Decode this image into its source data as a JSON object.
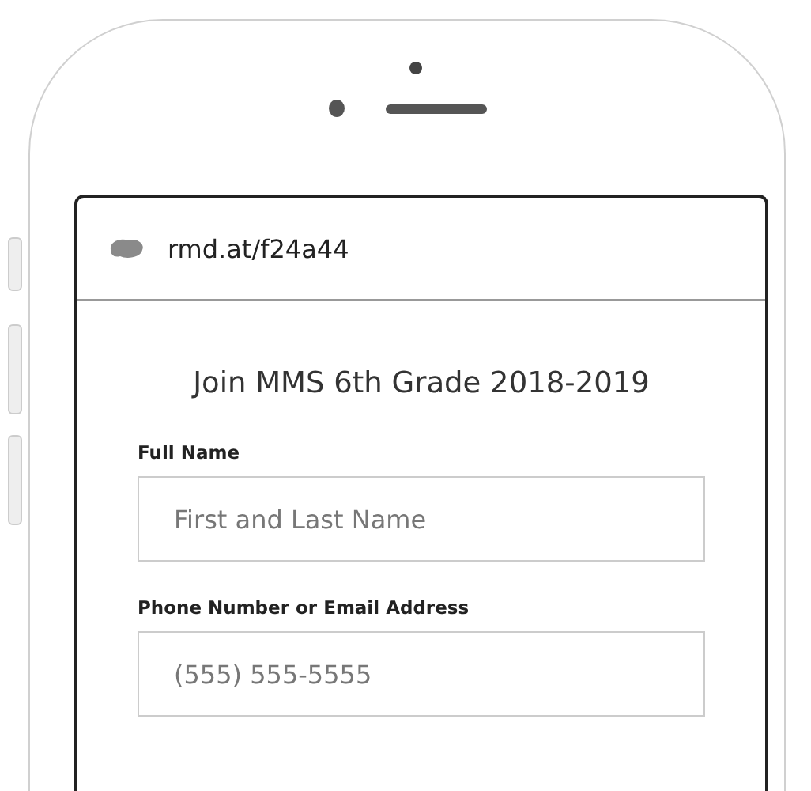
{
  "browser": {
    "url": "rmd.at/f24a44"
  },
  "form": {
    "title": "Join MMS 6th Grade 2018-2019",
    "fields": [
      {
        "label": "Full Name",
        "placeholder": "First and Last Name"
      },
      {
        "label": "Phone Number or Email Address",
        "placeholder": "(555) 555-5555"
      }
    ]
  }
}
